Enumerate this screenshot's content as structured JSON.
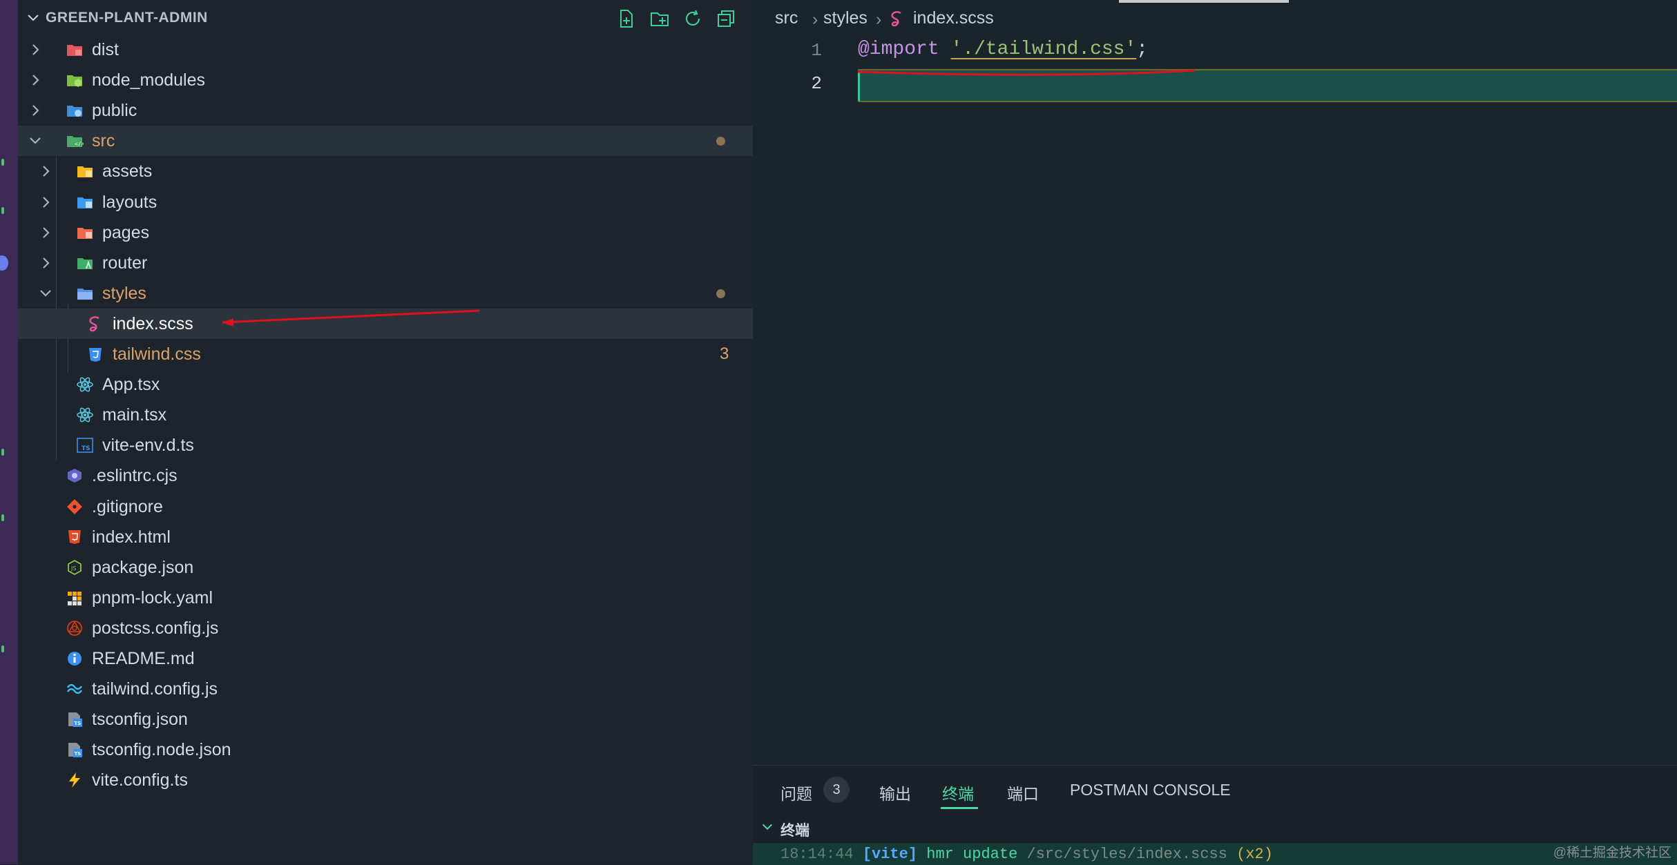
{
  "explorer": {
    "title": "GREEN-PLANT-ADMIN",
    "actions": [
      "new-file-icon",
      "new-folder-icon",
      "refresh-icon",
      "collapse-all-icon"
    ],
    "tree": [
      {
        "name": "dist",
        "type": "folder",
        "icon": "folder-dist-icon",
        "depth": 0,
        "expanded": false
      },
      {
        "name": "node_modules",
        "type": "folder",
        "icon": "folder-node-icon",
        "depth": 0,
        "expanded": false
      },
      {
        "name": "public",
        "type": "folder",
        "icon": "folder-public-icon",
        "depth": 0,
        "expanded": false
      },
      {
        "name": "src",
        "type": "folder",
        "icon": "folder-src-icon",
        "depth": 0,
        "expanded": true,
        "modified": true
      },
      {
        "name": "assets",
        "type": "folder",
        "icon": "folder-assets-icon",
        "depth": 1,
        "expanded": false
      },
      {
        "name": "layouts",
        "type": "folder",
        "icon": "folder-layouts-icon",
        "depth": 1,
        "expanded": false
      },
      {
        "name": "pages",
        "type": "folder",
        "icon": "folder-pages-icon",
        "depth": 1,
        "expanded": false
      },
      {
        "name": "router",
        "type": "folder",
        "icon": "folder-router-icon",
        "depth": 1,
        "expanded": false
      },
      {
        "name": "styles",
        "type": "folder",
        "icon": "folder-styles-icon",
        "depth": 1,
        "expanded": true,
        "modified": true
      },
      {
        "name": "index.scss",
        "type": "file",
        "icon": "sass-icon",
        "depth": 2,
        "selected": true
      },
      {
        "name": "tailwind.css",
        "type": "file",
        "icon": "css-icon",
        "depth": 2,
        "problems": "3"
      },
      {
        "name": "App.tsx",
        "type": "file",
        "icon": "react-icon",
        "depth": 1
      },
      {
        "name": "main.tsx",
        "type": "file",
        "icon": "react-icon",
        "depth": 1
      },
      {
        "name": "vite-env.d.ts",
        "type": "file",
        "icon": "typescript-icon",
        "depth": 1
      },
      {
        "name": ".eslintrc.cjs",
        "type": "file",
        "icon": "eslint-icon",
        "depth": 0
      },
      {
        "name": ".gitignore",
        "type": "file",
        "icon": "git-icon",
        "depth": 0
      },
      {
        "name": "index.html",
        "type": "file",
        "icon": "html-icon",
        "depth": 0
      },
      {
        "name": "package.json",
        "type": "file",
        "icon": "nodejs-icon",
        "depth": 0
      },
      {
        "name": "pnpm-lock.yaml",
        "type": "file",
        "icon": "pnpm-icon",
        "depth": 0
      },
      {
        "name": "postcss.config.js",
        "type": "file",
        "icon": "postcss-icon",
        "depth": 0
      },
      {
        "name": "README.md",
        "type": "file",
        "icon": "info-icon",
        "depth": 0
      },
      {
        "name": "tailwind.config.js",
        "type": "file",
        "icon": "tailwind-icon",
        "depth": 0
      },
      {
        "name": "tsconfig.json",
        "type": "file",
        "icon": "tsconfig-icon",
        "depth": 0
      },
      {
        "name": "tsconfig.node.json",
        "type": "file",
        "icon": "tsconfig-icon",
        "depth": 0
      },
      {
        "name": "vite.config.ts",
        "type": "file",
        "icon": "vite-icon",
        "depth": 0
      }
    ]
  },
  "editor": {
    "breadcrumb": [
      "src",
      "styles",
      "index.scss"
    ],
    "lines": [
      {
        "number": "1",
        "keyword": "@import",
        "string": "'./tailwind.css'",
        "punct": ";"
      },
      {
        "number": "2"
      }
    ],
    "active_line": "2"
  },
  "panel": {
    "tabs": [
      {
        "label": "问题",
        "badge": "3"
      },
      {
        "label": "输出"
      },
      {
        "label": "终端",
        "active": true
      },
      {
        "label": "端口"
      },
      {
        "label": "POSTMAN CONSOLE"
      }
    ],
    "terminal_title": "终端",
    "terminal_line": {
      "time": "18:14:44",
      "tag": "[vite]",
      "message": "hmr update",
      "path": "/src/styles/index.scss",
      "count": "(x2)"
    }
  },
  "watermark": "@稀土掘金技术社区",
  "colors": {
    "folder_modified": "#d9a36a",
    "selection": "#2c333b",
    "accent": "#4ad9a6",
    "annotation_red": "#e0111b"
  }
}
